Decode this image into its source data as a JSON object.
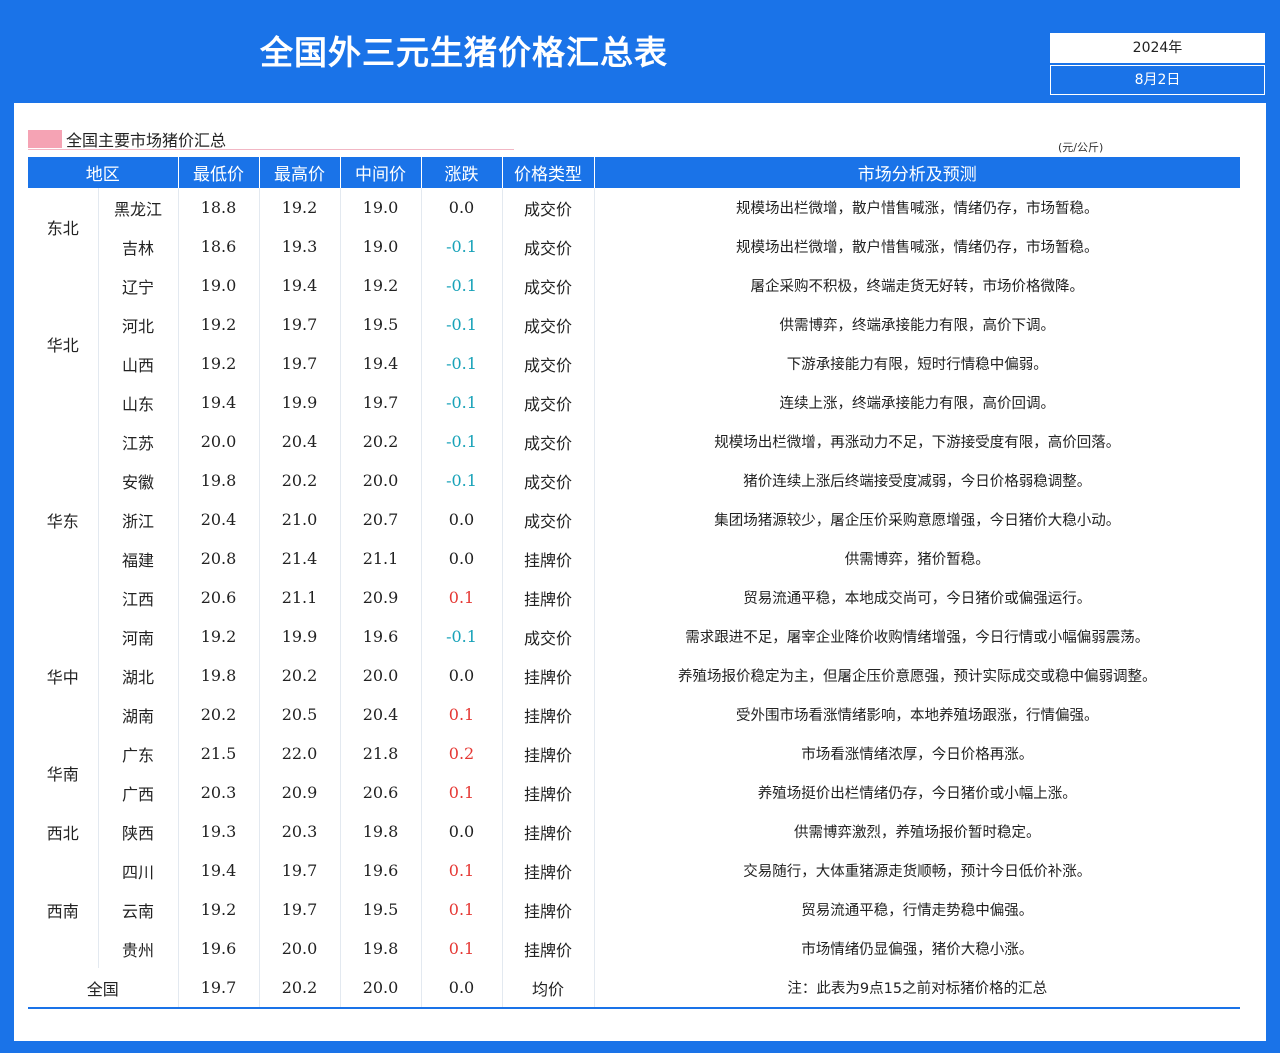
{
  "header": {
    "title": "全国外三元生猪价格汇总表",
    "year": "2024年",
    "date": "8月2日"
  },
  "section": {
    "title": "全国主要市场猪价汇总",
    "unit": "(元/公斤)"
  },
  "table": {
    "columns": [
      "地区",
      "最低价",
      "最高价",
      "中间价",
      "涨跌",
      "价格类型",
      "市场分析及预测"
    ],
    "regions": [
      {
        "name": "东北",
        "rows": 2
      },
      {
        "name": "华北",
        "rows": 4
      },
      {
        "name": "华东",
        "rows": 5
      },
      {
        "name": "华中",
        "rows": 3
      },
      {
        "name": "华南",
        "rows": 2
      },
      {
        "name": "西北",
        "rows": 1
      },
      {
        "name": "西南",
        "rows": 3
      }
    ],
    "rows": [
      {
        "province": "黑龙江",
        "min": "18.8",
        "max": "19.2",
        "mid": "19.0",
        "change": "0.0",
        "type": "成交价",
        "analysis": "规模场出栏微增，散户惜售喊涨，情绪仍存，市场暂稳。"
      },
      {
        "province": "吉林",
        "min": "18.6",
        "max": "19.3",
        "mid": "19.0",
        "change": "-0.1",
        "type": "成交价",
        "analysis": "规模场出栏微增，散户惜售喊涨，情绪仍存，市场暂稳。"
      },
      {
        "province": "辽宁",
        "min": "19.0",
        "max": "19.4",
        "mid": "19.2",
        "change": "-0.1",
        "type": "成交价",
        "analysis": "屠企采购不积极，终端走货无好转，市场价格微降。"
      },
      {
        "province": "河北",
        "min": "19.2",
        "max": "19.7",
        "mid": "19.5",
        "change": "-0.1",
        "type": "成交价",
        "analysis": "供需博弈，终端承接能力有限，高价下调。"
      },
      {
        "province": "山西",
        "min": "19.2",
        "max": "19.7",
        "mid": "19.4",
        "change": "-0.1",
        "type": "成交价",
        "analysis": "下游承接能力有限，短时行情稳中偏弱。"
      },
      {
        "province": "山东",
        "min": "19.4",
        "max": "19.9",
        "mid": "19.7",
        "change": "-0.1",
        "type": "成交价",
        "analysis": "连续上涨，终端承接能力有限，高价回调。"
      },
      {
        "province": "江苏",
        "min": "20.0",
        "max": "20.4",
        "mid": "20.2",
        "change": "-0.1",
        "type": "成交价",
        "analysis": "规模场出栏微增，再涨动力不足，下游接受度有限，高价回落。"
      },
      {
        "province": "安徽",
        "min": "19.8",
        "max": "20.2",
        "mid": "20.0",
        "change": "-0.1",
        "type": "成交价",
        "analysis": "猪价连续上涨后终端接受度减弱，今日价格弱稳调整。"
      },
      {
        "province": "浙江",
        "min": "20.4",
        "max": "21.0",
        "mid": "20.7",
        "change": "0.0",
        "type": "成交价",
        "analysis": "集团场猪源较少，屠企压价采购意愿增强，今日猪价大稳小动。"
      },
      {
        "province": "福建",
        "min": "20.8",
        "max": "21.4",
        "mid": "21.1",
        "change": "0.0",
        "type": "挂牌价",
        "analysis": "供需博弈，猪价暂稳。"
      },
      {
        "province": "江西",
        "min": "20.6",
        "max": "21.1",
        "mid": "20.9",
        "change": "0.1",
        "type": "挂牌价",
        "analysis": "贸易流通平稳，本地成交尚可，今日猪价或偏强运行。"
      },
      {
        "province": "河南",
        "min": "19.2",
        "max": "19.9",
        "mid": "19.6",
        "change": "-0.1",
        "type": "成交价",
        "analysis": "需求跟进不足，屠宰企业降价收购情绪增强，今日行情或小幅偏弱震荡。"
      },
      {
        "province": "湖北",
        "min": "19.8",
        "max": "20.2",
        "mid": "20.0",
        "change": "0.0",
        "type": "挂牌价",
        "analysis": "养殖场报价稳定为主，但屠企压价意愿强，预计实际成交或稳中偏弱调整。"
      },
      {
        "province": "湖南",
        "min": "20.2",
        "max": "20.5",
        "mid": "20.4",
        "change": "0.1",
        "type": "挂牌价",
        "analysis": "受外围市场看涨情绪影响，本地养殖场跟涨，行情偏强。"
      },
      {
        "province": "广东",
        "min": "21.5",
        "max": "22.0",
        "mid": "21.8",
        "change": "0.2",
        "type": "挂牌价",
        "analysis": "市场看涨情绪浓厚，今日价格再涨。"
      },
      {
        "province": "广西",
        "min": "20.3",
        "max": "20.9",
        "mid": "20.6",
        "change": "0.1",
        "type": "挂牌价",
        "analysis": "养殖场挺价出栏情绪仍存，今日猪价或小幅上涨。"
      },
      {
        "province": "陕西",
        "min": "19.3",
        "max": "20.3",
        "mid": "19.8",
        "change": "0.0",
        "type": "挂牌价",
        "analysis": "供需博弈激烈，养殖场报价暂时稳定。"
      },
      {
        "province": "四川",
        "min": "19.4",
        "max": "19.7",
        "mid": "19.6",
        "change": "0.1",
        "type": "挂牌价",
        "analysis": "交易随行，大体重猪源走货顺畅，预计今日低价补涨。"
      },
      {
        "province": "云南",
        "min": "19.2",
        "max": "19.7",
        "mid": "19.5",
        "change": "0.1",
        "type": "挂牌价",
        "analysis": "贸易流通平稳，行情走势稳中偏强。"
      },
      {
        "province": "贵州",
        "min": "19.6",
        "max": "20.0",
        "mid": "19.8",
        "change": "0.1",
        "type": "挂牌价",
        "analysis": "市场情绪仍显偏强，猪价大稳小涨。"
      }
    ],
    "total": {
      "label": "全国",
      "min": "19.7",
      "max": "20.2",
      "mid": "20.0",
      "change": "0.0",
      "type": "均价",
      "analysis": "注：此表为9点15之前对标猪价格的汇总"
    }
  }
}
